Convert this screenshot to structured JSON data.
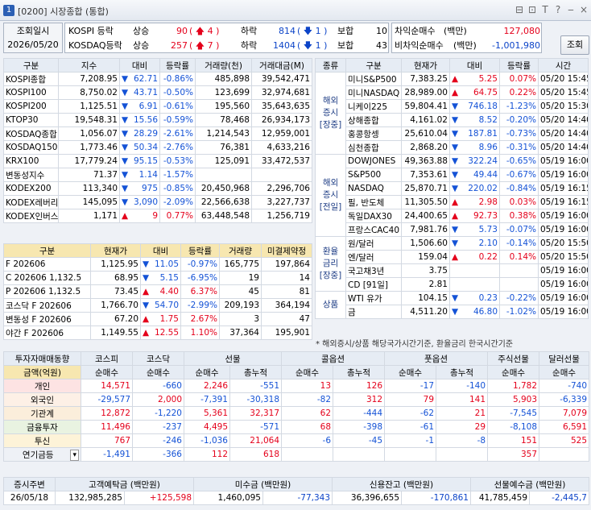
{
  "window": {
    "number": "1",
    "title": "[0200] 시장종합 (통합)",
    "controls": [
      "⊟",
      "⊡",
      "T",
      "?",
      "‒",
      "×"
    ]
  },
  "top": {
    "label1": "조회일시",
    "date": "2026/05/20",
    "kospi": {
      "name": "KOSPI 등락",
      "up_label": "상승",
      "up": "90",
      "up_limit": "4",
      "down_label": "하락",
      "down": "814",
      "down_limit": "1",
      "flat_label": "보합",
      "flat": "10"
    },
    "kosdaq": {
      "name": "KOSDAQ등락",
      "up_label": "상승",
      "up": "257",
      "up_limit": "7",
      "down_label": "하락",
      "down": "1404",
      "down_limit": "1",
      "flat_label": "보합",
      "flat": "43"
    },
    "arb": {
      "label": "차익순매수",
      "unit": "(백만)",
      "value": "127,080"
    },
    "narb": {
      "label": "비차익순매수",
      "unit": "(백만)",
      "value": "-1,001,980"
    },
    "query_button": "조회"
  },
  "indices": {
    "headers": [
      "구분",
      "지수",
      "대비",
      "등락률",
      "거래량(천)",
      "거래대금(M)"
    ],
    "rows": [
      [
        "KOSPI종합",
        "7,208.95",
        "▼",
        "62.71",
        "-0.86%",
        "485,898",
        "39,542,471",
        "d"
      ],
      [
        "KOSPI100",
        "8,750.02",
        "▼",
        "43.71",
        "-0.50%",
        "123,699",
        "32,974,681",
        "d"
      ],
      [
        "KOSPI200",
        "1,125.51",
        "▼",
        "6.91",
        "-0.61%",
        "195,560",
        "35,643,635",
        "d"
      ],
      [
        "KTOP30",
        "19,548.31",
        "▼",
        "15.56",
        "-0.59%",
        "78,468",
        "26,934,173",
        "d"
      ],
      [
        "KOSDAQ종합",
        "1,056.07",
        "▼",
        "28.29",
        "-2.61%",
        "1,214,543",
        "12,959,001",
        "d"
      ],
      [
        "KOSDAQ150",
        "1,773.46",
        "▼",
        "50.34",
        "-2.76%",
        "76,381",
        "4,633,216",
        "d"
      ],
      [
        "KRX100",
        "17,779.24",
        "▼",
        "95.15",
        "-0.53%",
        "125,091",
        "33,472,537",
        "d"
      ],
      [
        "변동성지수",
        "71.37",
        "▼",
        "1.14",
        "-1.57%",
        "",
        "",
        "d"
      ],
      [
        "KODEX200",
        "113,340",
        "▼",
        "975",
        "-0.85%",
        "20,450,968",
        "2,296,706",
        "d"
      ],
      [
        "KODEX레버리지",
        "145,095",
        "▼",
        "3,090",
        "-2.09%",
        "22,566,638",
        "3,227,737",
        "d"
      ],
      [
        "KODEX인버스",
        "1,171",
        "▲",
        "9",
        "0.77%",
        "63,448,548",
        "1,256,719",
        "u"
      ]
    ]
  },
  "futures": {
    "headers": [
      "구분",
      "현재가",
      "대비",
      "등락률",
      "거래량",
      "미결제약정"
    ],
    "rows": [
      [
        "F 202606",
        "1,125.95",
        "▼",
        "11.05",
        "-0.97%",
        "165,775",
        "197,864",
        "d"
      ],
      [
        "C 202606 1,132.5",
        "68.95",
        "▼",
        "5.15",
        "-6.95%",
        "19",
        "14",
        "d"
      ],
      [
        "P 202606 1,132.5",
        "73.45",
        "▲",
        "4.40",
        "6.37%",
        "45",
        "81",
        "u"
      ],
      [
        "코스닥 F 202606",
        "1,766.70",
        "▼",
        "54.70",
        "-2.99%",
        "209,193",
        "364,194",
        "d"
      ],
      [
        "변동성 F 202606",
        "67.20",
        "▲",
        "1.75",
        "2.67%",
        "3",
        "47",
        "u"
      ],
      [
        "야간 F 202606",
        "1,149.55",
        "▲",
        "12.55",
        "1.10%",
        "37,364",
        "195,901",
        "u"
      ]
    ]
  },
  "overseas": {
    "headers": [
      "종류",
      "구분",
      "현재가",
      "대비",
      "등락률",
      "시간"
    ],
    "groups": [
      {
        "label": "해외\n증시\n[장중]",
        "rows": [
          [
            "미니S&P500",
            "7,383.25",
            "▲",
            "5.25",
            "0.07%",
            "05/20 15:45",
            "u"
          ],
          [
            "미니NASDAQ",
            "28,989.00",
            "▲",
            "64.75",
            "0.22%",
            "05/20 15:45",
            "u"
          ],
          [
            "니케이225",
            "59,804.41",
            "▼",
            "746.18",
            "-1.23%",
            "05/20 15:30",
            "d"
          ],
          [
            "상해종합",
            "4,161.02",
            "▼",
            "8.52",
            "-0.20%",
            "05/20 14:40",
            "d"
          ],
          [
            "홍콩항셍",
            "25,610.04",
            "▼",
            "187.81",
            "-0.73%",
            "05/20 14:40",
            "d"
          ],
          [
            "심천종합",
            "2,868.20",
            "▼",
            "8.96",
            "-0.31%",
            "05/20 14:40",
            "d"
          ]
        ]
      },
      {
        "label": "해외\n증시\n[전일]",
        "rows": [
          [
            "DOWJONES",
            "49,363.88",
            "▼",
            "322.24",
            "-0.65%",
            "05/19 16:00",
            "d"
          ],
          [
            "S&P500",
            "7,353.61",
            "▼",
            "49.44",
            "-0.67%",
            "05/19 16:00",
            "d"
          ],
          [
            "NASDAQ",
            "25,870.71",
            "▼",
            "220.02",
            "-0.84%",
            "05/19 16:15",
            "d"
          ],
          [
            "필, 반도체",
            "11,305.50",
            "▲",
            "2.98",
            "0.03%",
            "05/19 16:15",
            "u"
          ],
          [
            "독일DAX30",
            "24,400.65",
            "▲",
            "92.73",
            "0.38%",
            "05/19 16:00",
            "u"
          ],
          [
            "프랑스CAC40",
            "7,981.76",
            "▼",
            "5.73",
            "-0.07%",
            "05/19 16:00",
            "d"
          ]
        ]
      },
      {
        "label": "환율\n금리\n[장중]",
        "rows": [
          [
            "원/달러",
            "1,506.60",
            "▼",
            "2.10",
            "-0.14%",
            "05/20 15:50",
            "d"
          ],
          [
            "엔/달러",
            "159.04",
            "▲",
            "0.22",
            "0.14%",
            "05/20 15:50",
            "u"
          ],
          [
            "국고채3년",
            "3.75",
            "",
            "",
            "",
            "05/19 16:00",
            "n"
          ],
          [
            "CD [91일]",
            "2.81",
            "",
            "",
            "",
            "05/19 16:00",
            "n"
          ]
        ]
      },
      {
        "label": "상품",
        "rows": [
          [
            "WTI 유가",
            "104.15",
            "▼",
            "0.23",
            "-0.22%",
            "05/19 16:00",
            "d"
          ],
          [
            "금",
            "4,511.20",
            "▼",
            "46.80",
            "-1.02%",
            "05/19 16:00",
            "d"
          ]
        ]
      }
    ],
    "note": "* 해외증시/상품 해당국가시간기준, 환율금리 한국시간기준"
  },
  "investors": {
    "top_headers": [
      "투자자매매동향",
      "코스피",
      "코스닥",
      "선물",
      "콜옵션",
      "풋옵션",
      "주식선물",
      "달러선물"
    ],
    "unit_label": "금액(억원)",
    "sub_headers": [
      "순매수",
      "순매수",
      "순매수",
      "총누적",
      "순매수",
      "총누적",
      "순매수",
      "총누적",
      "순매수",
      "순매수"
    ],
    "rows": [
      {
        "name": "개인",
        "v": [
          "14,571",
          "-660",
          "2,246",
          "-551",
          "13",
          "126",
          "-17",
          "-140",
          "1,782",
          "-740"
        ]
      },
      {
        "name": "외국인",
        "v": [
          "-29,577",
          "2,000",
          "-7,391",
          "-30,318",
          "-82",
          "312",
          "79",
          "141",
          "5,903",
          "-6,339"
        ]
      },
      {
        "name": "기관계",
        "v": [
          "12,872",
          "-1,220",
          "5,361",
          "32,317",
          "62",
          "-444",
          "-62",
          "21",
          "-7,545",
          "7,079"
        ]
      },
      {
        "name": "금융투자",
        "v": [
          "11,496",
          "-237",
          "4,495",
          "-571",
          "68",
          "-398",
          "-61",
          "29",
          "-8,108",
          "6,591"
        ]
      },
      {
        "name": "투신",
        "v": [
          "767",
          "-246",
          "-1,036",
          "21,064",
          "-6",
          "-45",
          "-1",
          "-8",
          "151",
          "525"
        ]
      },
      {
        "name": "연기금등",
        "v": [
          "-1,491",
          "-366",
          "112",
          "618",
          "",
          "",
          "",
          "",
          "357",
          ""
        ]
      }
    ]
  },
  "bottom": {
    "headers": [
      "증시주변",
      "고객예탁금 (백만원)",
      "미수금 (백만원)",
      "신용잔고 (백만원)",
      "선물예수금 (백만원)"
    ],
    "date": "26/05/18",
    "deposit": "132,985,285",
    "deposit_chg": "+125,598",
    "unpaid": "1,460,095",
    "unpaid_chg": "-77,343",
    "credit": "36,396,655",
    "credit_chg": "-170,861",
    "fut_dep": "41,785,459",
    "fut_dep_chg": "-2,445,7"
  }
}
